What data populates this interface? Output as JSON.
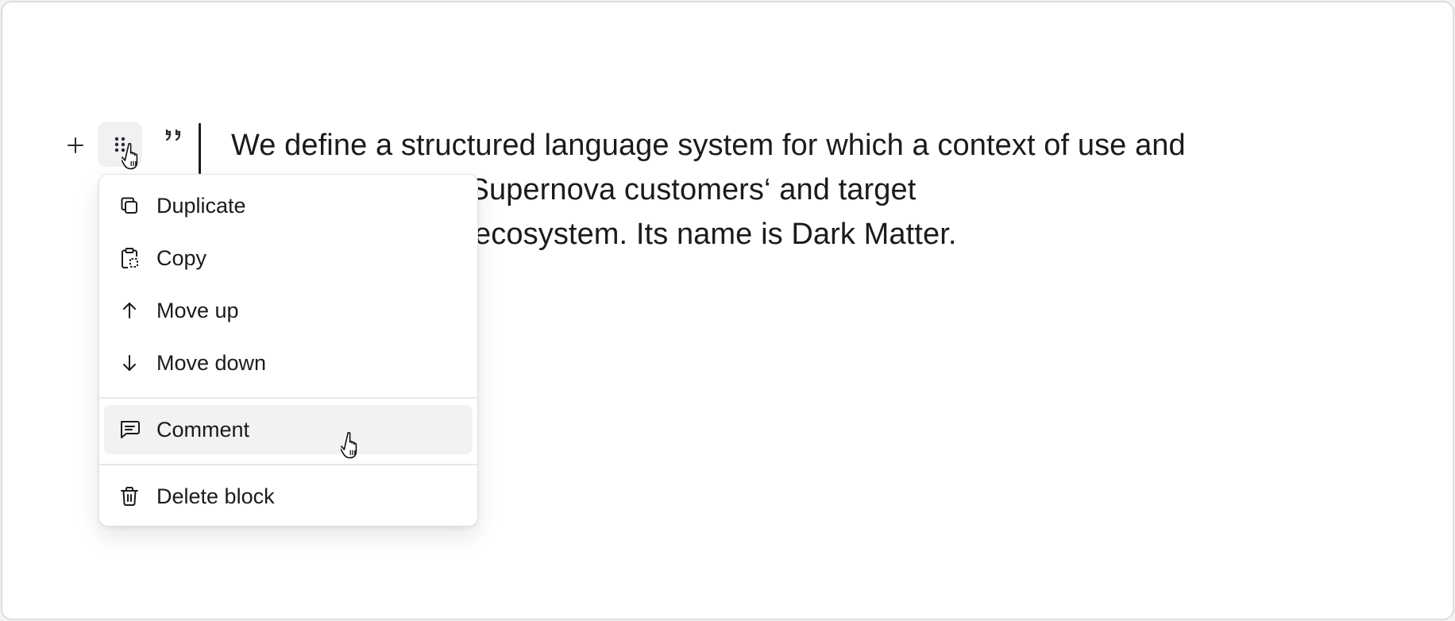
{
  "block": {
    "quote_text": "We define a structured language system for which a context of use and\nishes harmony in Supernova customers‘ and target\nriences within the ecosystem. Its name is Dark Matter."
  },
  "gutter": {
    "add_icon": "plus-icon",
    "drag_icon": "drag-handle-icon",
    "block_type_icon": "quote-icon"
  },
  "menu": {
    "items": [
      {
        "label": "Duplicate",
        "icon": "duplicate-icon"
      },
      {
        "label": "Copy",
        "icon": "clipboard-icon"
      },
      {
        "label": "Move up",
        "icon": "arrow-up-icon"
      },
      {
        "label": "Move down",
        "icon": "arrow-down-icon"
      },
      {
        "label": "Comment",
        "icon": "comment-icon",
        "hovered": true
      },
      {
        "label": "Delete block",
        "icon": "trash-icon"
      }
    ]
  },
  "colors": {
    "text": "#1b1b1f",
    "hover_bg": "#f2f2f3",
    "border": "#e2e3e6"
  }
}
